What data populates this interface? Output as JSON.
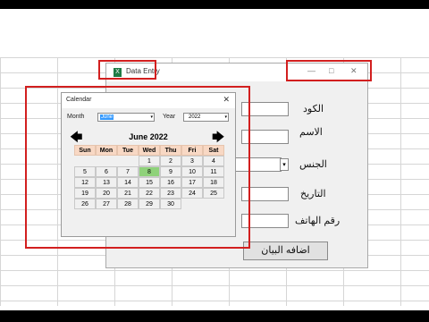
{
  "form": {
    "title": "Data Entry",
    "app_icon_letter": "X",
    "minimize_glyph": "—",
    "maximize_glyph": "□",
    "close_glyph": "✕",
    "labels": {
      "code": "الكود",
      "name": "الاسم",
      "gender": "الجنس",
      "date": "التاريخ",
      "phone": "رقم الهاتف"
    },
    "combo_arrow_glyph": "▾",
    "add_button": "اضافه البيان"
  },
  "calendar": {
    "title": "Calendar",
    "close_glyph": "✕",
    "month_label": "Month",
    "month_value": "June",
    "year_label": "Year",
    "year_value": "2022",
    "dropdown_glyph": "▾",
    "prev_glyph": "🡄",
    "next_glyph": "🡆",
    "heading": "June 2022",
    "weekdays": [
      "Sun",
      "Mon",
      "Tue",
      "Wed",
      "Thu",
      "Fri",
      "Sat"
    ],
    "days": [
      "",
      "",
      "",
      "1",
      "2",
      "3",
      "4",
      "5",
      "6",
      "7",
      "8",
      "9",
      "10",
      "11",
      "12",
      "13",
      "14",
      "15",
      "16",
      "17",
      "18",
      "19",
      "20",
      "21",
      "22",
      "23",
      "24",
      "25",
      "26",
      "27",
      "28",
      "29",
      "30"
    ],
    "highlighted_day": "8",
    "colors": {
      "header_bg": "#f8d8c4",
      "today_bg": "#8fd27a",
      "annotation_red": "#d21f1f"
    }
  }
}
